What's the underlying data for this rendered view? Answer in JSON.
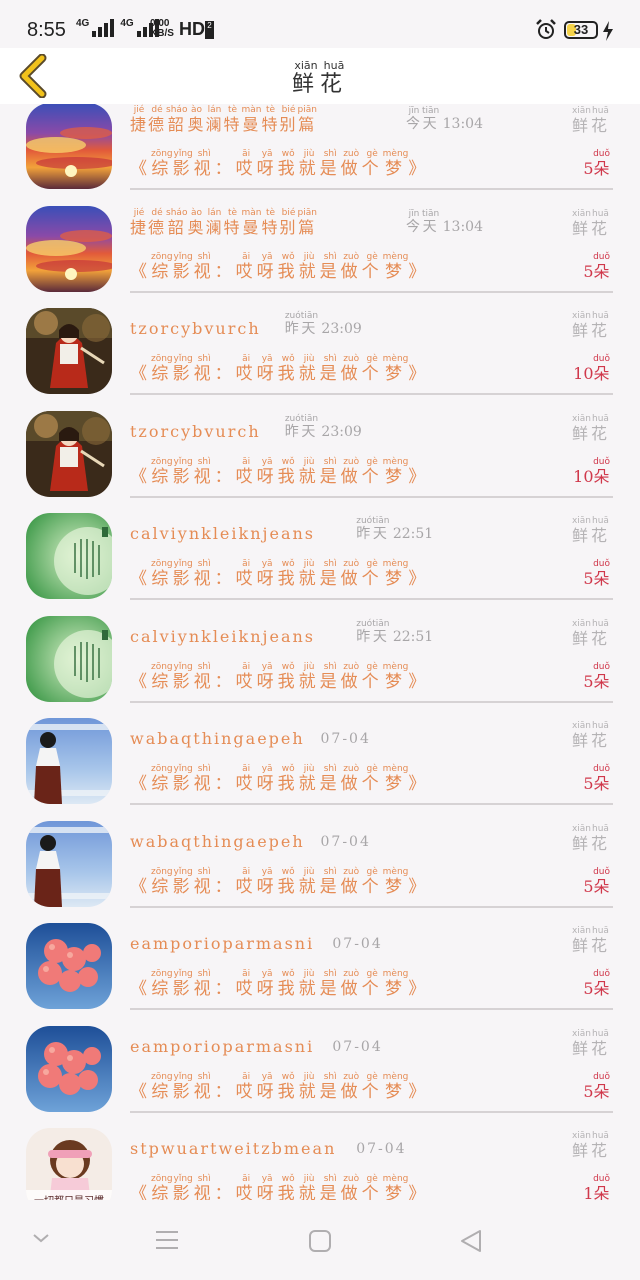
{
  "status_bar": {
    "time": "8:55",
    "net1": "4G",
    "net2": "4G",
    "speed_value": "0.00",
    "speed_unit": "KB/S",
    "hd": "HD",
    "hd_sub": "2",
    "battery": "33"
  },
  "header": {
    "title": [
      {
        "char": "鲜",
        "pinyin": "xiān"
      },
      {
        "char": "花",
        "pinyin": "huā"
      }
    ]
  },
  "gift_label": [
    {
      "char": "鲜",
      "pinyin": "xiān"
    },
    {
      "char": "花",
      "pinyin": "huā"
    }
  ],
  "target_text": [
    {
      "char": "《",
      "pinyin": ""
    },
    {
      "char": "综",
      "pinyin": "zōng"
    },
    {
      "char": "影",
      "pinyin": "yǐng"
    },
    {
      "char": "视",
      "pinyin": "shì"
    },
    {
      "char": "：",
      "pinyin": ""
    },
    {
      "char": "哎",
      "pinyin": "āi"
    },
    {
      "char": "呀",
      "pinyin": "yā"
    },
    {
      "char": "我",
      "pinyin": "wǒ"
    },
    {
      "char": "就",
      "pinyin": "jiù"
    },
    {
      "char": "是",
      "pinyin": "shì"
    },
    {
      "char": "做",
      "pinyin": "zuò"
    },
    {
      "char": "个",
      "pinyin": "gè"
    },
    {
      "char": "梦",
      "pinyin": "mèng"
    },
    {
      "char": "》",
      "pinyin": ""
    }
  ],
  "unit": {
    "char": "朵",
    "pinyin": "duǒ"
  },
  "rows": [
    {
      "user_chars": [
        {
          "char": "捷",
          "pinyin": "jié"
        },
        {
          "char": "德",
          "pinyin": "dé"
        },
        {
          "char": "韶",
          "pinyin": "sháo"
        },
        {
          "char": "奥",
          "pinyin": "ào"
        },
        {
          "char": "澜",
          "pinyin": "lán"
        },
        {
          "char": "特",
          "pinyin": "tè"
        },
        {
          "char": "曼",
          "pinyin": "màn"
        },
        {
          "char": "特",
          "pinyin": "tè"
        },
        {
          "char": "别",
          "pinyin": "bié"
        },
        {
          "char": "篇",
          "pinyin": "piān"
        }
      ],
      "day_chars": [
        {
          "char": "今",
          "pinyin": "jīn"
        },
        {
          "char": "天",
          "pinyin": "tiān"
        }
      ],
      "time": "13:04",
      "count": "5",
      "avatar": "sunset"
    },
    {
      "user_chars": [
        {
          "char": "捷",
          "pinyin": "jié"
        },
        {
          "char": "德",
          "pinyin": "dé"
        },
        {
          "char": "韶",
          "pinyin": "sháo"
        },
        {
          "char": "奥",
          "pinyin": "ào"
        },
        {
          "char": "澜",
          "pinyin": "lán"
        },
        {
          "char": "特",
          "pinyin": "tè"
        },
        {
          "char": "曼",
          "pinyin": "màn"
        },
        {
          "char": "特",
          "pinyin": "tè"
        },
        {
          "char": "别",
          "pinyin": "bié"
        },
        {
          "char": "篇",
          "pinyin": "piān"
        }
      ],
      "day_chars": [
        {
          "char": "今",
          "pinyin": "jīn"
        },
        {
          "char": "天",
          "pinyin": "tiān"
        }
      ],
      "time": "13:04",
      "count": "5",
      "avatar": "sunset"
    },
    {
      "user": "tzorcybvurch",
      "day_chars": [
        {
          "char": "昨",
          "pinyin": "zuó"
        },
        {
          "char": "天",
          "pinyin": "tiān"
        }
      ],
      "time": "23:09",
      "count": "10",
      "avatar": "shrine"
    },
    {
      "user": "tzorcybvurch",
      "day_chars": [
        {
          "char": "昨",
          "pinyin": "zuó"
        },
        {
          "char": "天",
          "pinyin": "tiān"
        }
      ],
      "time": "23:09",
      "count": "10",
      "avatar": "shrine"
    },
    {
      "user": "calviynkleiknjeans",
      "day_chars": [
        {
          "char": "昨",
          "pinyin": "zuó"
        },
        {
          "char": "天",
          "pinyin": "tiān"
        }
      ],
      "time": "22:51",
      "count": "5",
      "avatar": "green"
    },
    {
      "user": "calviynkleiknjeans",
      "day_chars": [
        {
          "char": "昨",
          "pinyin": "zuó"
        },
        {
          "char": "天",
          "pinyin": "tiān"
        }
      ],
      "time": "22:51",
      "count": "5",
      "avatar": "green"
    },
    {
      "user": "wabaqthingaepeh",
      "time": "07-04",
      "count": "5",
      "avatar": "girl"
    },
    {
      "user": "wabaqthingaepeh",
      "time": "07-04",
      "count": "5",
      "avatar": "girl"
    },
    {
      "user": "eamporioparmasni",
      "time": "07-04",
      "count": "5",
      "avatar": "balloons"
    },
    {
      "user": "eamporioparmasni",
      "time": "07-04",
      "count": "5",
      "avatar": "balloons"
    },
    {
      "user": "stpwuartweitzbmean",
      "time": "07-04",
      "count": "1",
      "avatar": "cartoon",
      "avatar_text": "一切都只是习惯"
    }
  ],
  "icons": {
    "back": "chevron-left-icon",
    "alarm": "alarm-icon",
    "charge": "lightning-icon",
    "nav": [
      "chevron-down-icon",
      "menu-icon",
      "home-square-icon",
      "back-triangle-icon"
    ]
  },
  "colors": {
    "accent": "#e58c55",
    "count": "#d0384b",
    "muted": "#a8a6a8",
    "back_arrow": "#f2c21b"
  }
}
